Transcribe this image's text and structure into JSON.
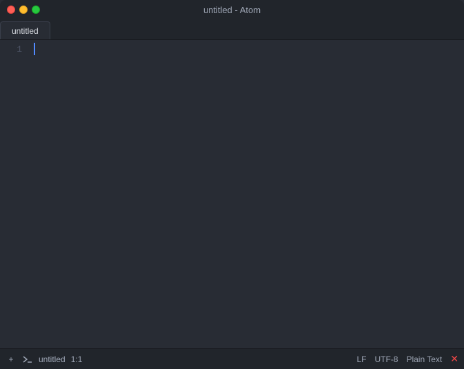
{
  "titleBar": {
    "title": "untitled - Atom",
    "trafficLights": {
      "close": "close",
      "minimize": "minimize",
      "maximize": "maximize"
    }
  },
  "tabs": [
    {
      "label": "untitled",
      "active": true
    }
  ],
  "editor": {
    "lines": [
      {
        "number": "1",
        "content": ""
      }
    ]
  },
  "statusBar": {
    "left": {
      "addIcon": "+",
      "terminalIcon": "❯",
      "filename": "untitled",
      "position": "1:1"
    },
    "right": {
      "lineEnding": "LF",
      "encoding": "UTF-8",
      "grammar": "Plain Text",
      "errorIcon": "✕"
    }
  }
}
